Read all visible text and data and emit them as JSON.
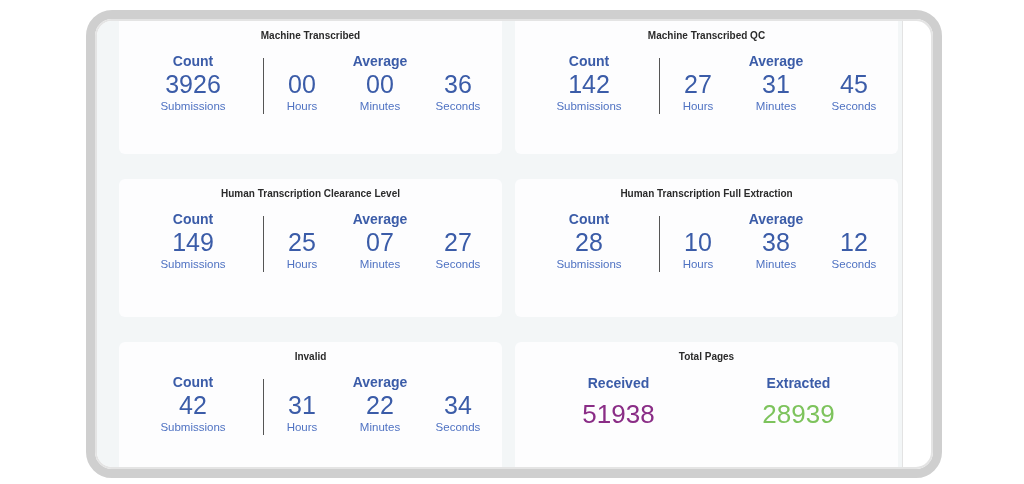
{
  "cards": [
    {
      "kind": "timing",
      "title": "Machine Transcribed",
      "count_label": "Count",
      "count": "3926",
      "count_unit": "Submissions",
      "average_label": "Average",
      "average": [
        {
          "value": "00",
          "unit": "Hours"
        },
        {
          "value": "00",
          "unit": "Minutes"
        },
        {
          "value": "36",
          "unit": "Seconds"
        }
      ]
    },
    {
      "kind": "timing",
      "title": "Machine Transcribed QC",
      "count_label": "Count",
      "count": "142",
      "count_unit": "Submissions",
      "average_label": "Average",
      "average": [
        {
          "value": "27",
          "unit": "Hours"
        },
        {
          "value": "31",
          "unit": "Minutes"
        },
        {
          "value": "45",
          "unit": "Seconds"
        }
      ]
    },
    {
      "kind": "timing",
      "title": "Human Transcription Clearance Level",
      "count_label": "Count",
      "count": "149",
      "count_unit": "Submissions",
      "average_label": "Average",
      "average": [
        {
          "value": "25",
          "unit": "Hours"
        },
        {
          "value": "07",
          "unit": "Minutes"
        },
        {
          "value": "27",
          "unit": "Seconds"
        }
      ]
    },
    {
      "kind": "timing",
      "title": "Human Transcription Full Extraction",
      "count_label": "Count",
      "count": "28",
      "count_unit": "Submissions",
      "average_label": "Average",
      "average": [
        {
          "value": "10",
          "unit": "Hours"
        },
        {
          "value": "38",
          "unit": "Minutes"
        },
        {
          "value": "12",
          "unit": "Seconds"
        }
      ]
    },
    {
      "kind": "timing",
      "title": "Invalid",
      "count_label": "Count",
      "count": "42",
      "count_unit": "Submissions",
      "average_label": "Average",
      "average": [
        {
          "value": "31",
          "unit": "Hours"
        },
        {
          "value": "22",
          "unit": "Minutes"
        },
        {
          "value": "34",
          "unit": "Seconds"
        }
      ]
    },
    {
      "kind": "totals",
      "title": "Total Pages",
      "totals": [
        {
          "label": "Received",
          "value": "51938",
          "color": "#8a2d86"
        },
        {
          "label": "Extracted",
          "value": "28939",
          "color": "#7dc35c"
        }
      ]
    }
  ]
}
